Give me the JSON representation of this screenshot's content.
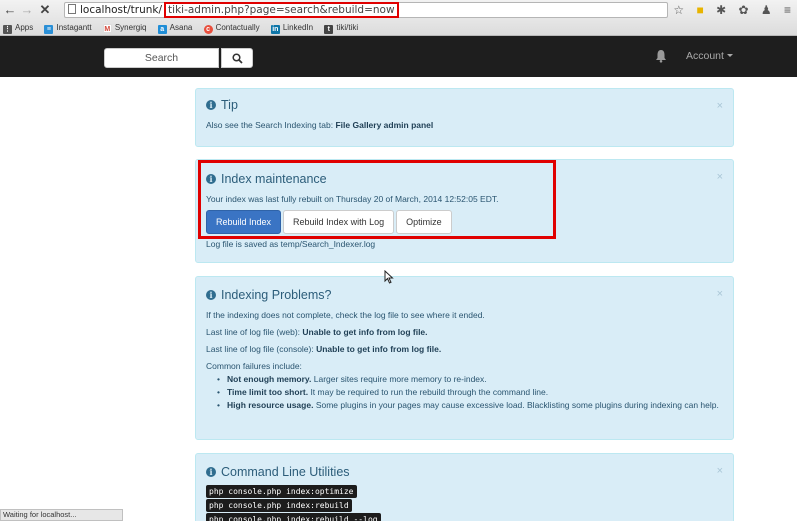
{
  "browser": {
    "url_host": "localhost/trunk/",
    "url_path": "tiki-admin.php?page=search&rebuild=now",
    "bookmarks": [
      {
        "label": "Apps",
        "icon": "apps-grid-icon",
        "color": "#555555"
      },
      {
        "label": "Instagantt",
        "icon": "instagantt-icon",
        "color": "#2a8fd6"
      },
      {
        "label": "Synergiq",
        "icon": "gmail-icon",
        "color": "#d44638"
      },
      {
        "label": "Asana",
        "icon": "asana-icon",
        "color": "#1f8dd6"
      },
      {
        "label": "Contactually",
        "icon": "contactually-icon",
        "color": "#e84e3c"
      },
      {
        "label": "LinkedIn",
        "icon": "linkedin-icon",
        "color": "#0e76a8"
      },
      {
        "label": "tiki/tiki",
        "icon": "tiki-icon",
        "color": "#444444"
      }
    ],
    "status_text": "Waiting for localhost..."
  },
  "navbar": {
    "search_placeholder": "Search",
    "account_label": "Account"
  },
  "panels": {
    "tip": {
      "title": "Tip",
      "text_prefix": "Also see the Search Indexing tab: ",
      "text_bold": "File Gallery admin panel"
    },
    "index": {
      "title": "Index maintenance",
      "text": "Your index was last fully rebuilt on Thursday 20 of March, 2014 12:52:05 EDT.",
      "buttons": {
        "rebuild": "Rebuild Index",
        "rebuild_log": "Rebuild Index with Log",
        "optimize": "Optimize"
      },
      "log_note": "Log file is saved as temp/Search_Indexer.log"
    },
    "problems": {
      "title": "Indexing Problems?",
      "line1": "If the indexing does not complete, check the log file to see where it ended.",
      "web_label": "Last line of log file (web): ",
      "web_value": "Unable to get info from log file.",
      "console_label": "Last line of log file (console): ",
      "console_value": "Unable to get info from log file.",
      "common": "Common failures include:",
      "items": [
        {
          "bold": "Not enough memory.",
          "text": " Larger sites require more memory to re-index."
        },
        {
          "bold": "Time limit too short.",
          "text": " It may be required to run the rebuild through the command line."
        },
        {
          "bold": "High resource usage.",
          "text": " Some plugins in your pages may cause excessive load. Blacklisting some plugins during indexing can help."
        }
      ]
    },
    "cli": {
      "title": "Command Line Utilities",
      "commands": [
        "php console.php index:optimize",
        "php console.php index:rebuild",
        "php console.php index:rebuild --log"
      ]
    }
  },
  "close_glyph": "×",
  "colors": {
    "highlight": "#e00000",
    "primary_button": "#3a74c4",
    "panel_bg": "#d9edf7"
  }
}
